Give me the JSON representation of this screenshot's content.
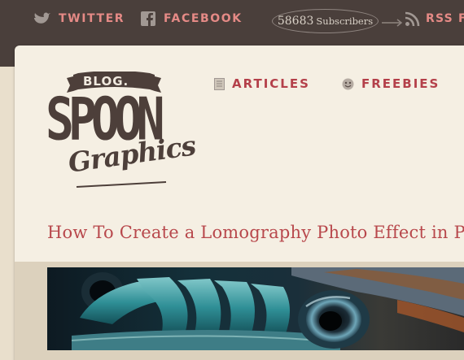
{
  "social": {
    "twitter_label": "TWITTER",
    "facebook_label": "FACEBOOK",
    "subscribers_count": "58683",
    "subscribers_label": "Subscribers",
    "rss_label": "RSS F"
  },
  "logo": {
    "banner": "BLOG.",
    "main": "SPOON",
    "sub": "Graphics"
  },
  "nav": {
    "articles": "ARTICLES",
    "freebies": "FREEBIES"
  },
  "post": {
    "title": "How To Create a Lomography Photo Effect in Ph"
  },
  "colors": {
    "topbar": "#4a3f3b",
    "accent_pink": "#e58a86",
    "nav_red": "#b4404a",
    "title_red": "#b8484c",
    "paper": "#f5efe3",
    "logo_brown": "#4d3f3a"
  },
  "icons": {
    "twitter": "bird-icon",
    "facebook": "facebook-icon",
    "rss": "rss-icon",
    "articles": "document-icon",
    "freebies": "smiley-icon"
  }
}
